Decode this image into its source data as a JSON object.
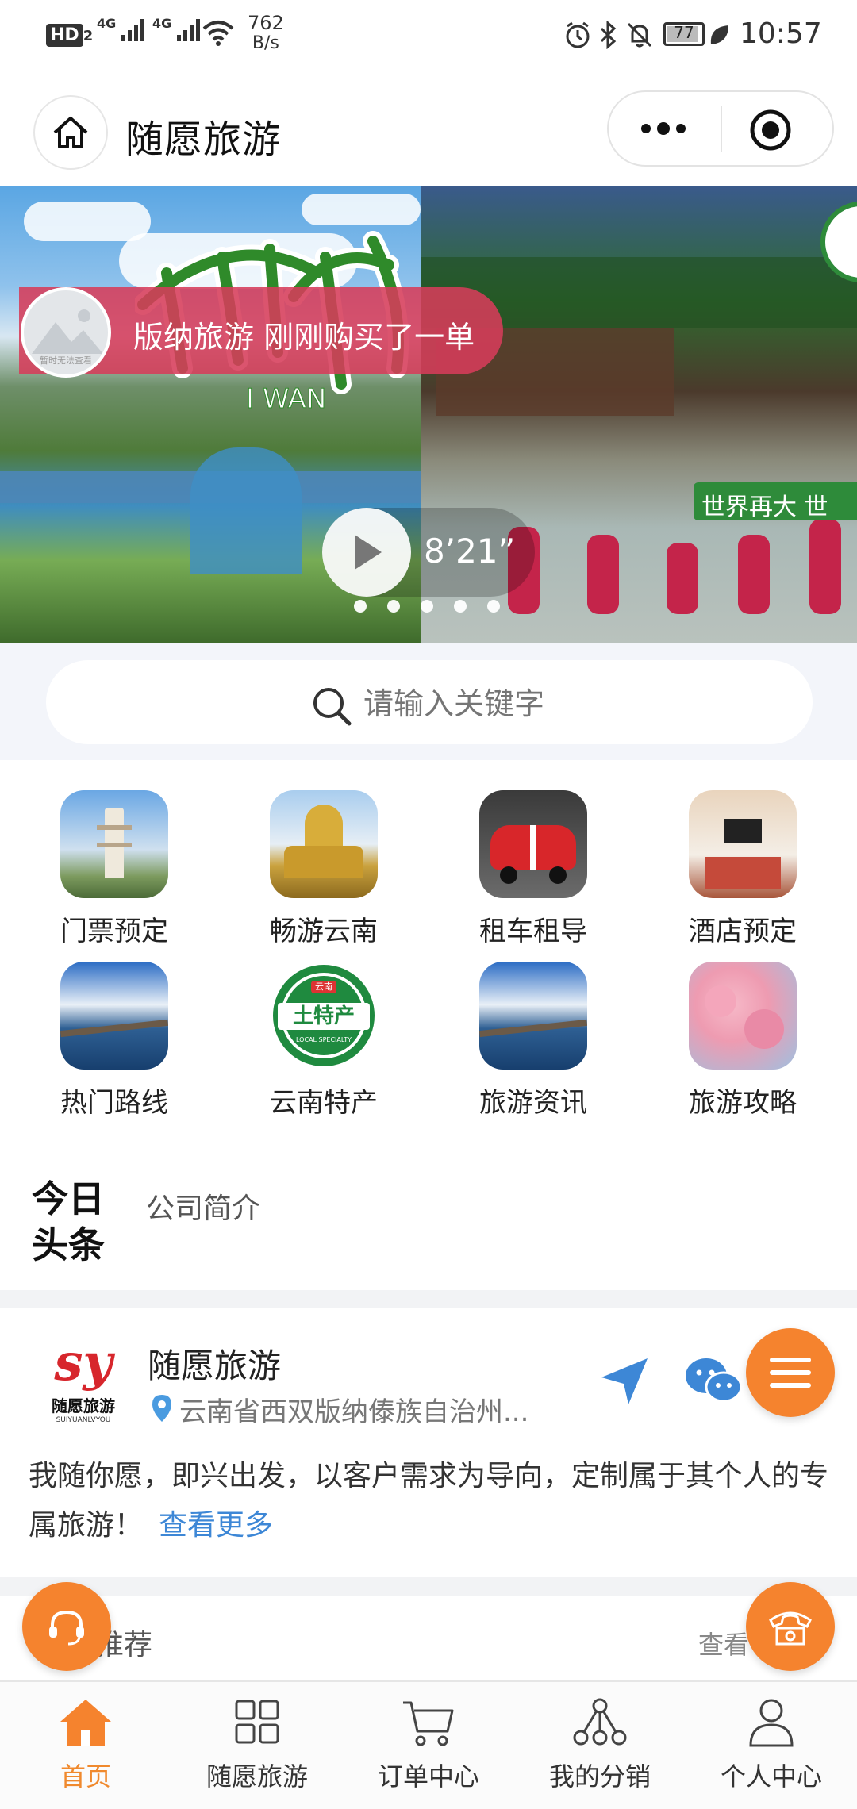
{
  "status_bar": {
    "hd_label": "HD",
    "hd_sub": "2",
    "net1": "4G",
    "net2": "4G",
    "speed_value": "762",
    "speed_unit": "B/s",
    "battery": "77",
    "time": "10:57"
  },
  "header": {
    "title": "随愿旅游"
  },
  "banner": {
    "notification": "版纳旅游 刚刚购买了一单",
    "avatar_caption": "暂时无法查看",
    "video_duration": "8’21”",
    "art_subtitle": "世界再大 世",
    "art_english": "I WAN",
    "dots_count": 5
  },
  "search": {
    "placeholder": "请输入关键字"
  },
  "grid": {
    "items": [
      {
        "label": "门票预定",
        "icon": "pagoda-icon"
      },
      {
        "label": "畅游云南",
        "icon": "golden-temple-icon"
      },
      {
        "label": "租车租导",
        "icon": "red-car-icon"
      },
      {
        "label": "酒店预定",
        "icon": "hotel-room-icon"
      },
      {
        "label": "热门路线",
        "icon": "lake-pier-icon"
      },
      {
        "label": "云南特产",
        "icon": "local-specialty-icon"
      },
      {
        "label": "旅游资讯",
        "icon": "lake-pier-icon"
      },
      {
        "label": "旅游攻略",
        "icon": "cherry-blossom-icon"
      }
    ],
    "specialty_badge_top": "云南",
    "specialty_badge_main": "土特产",
    "specialty_badge_ring": "LOCAL SPECIALTY"
  },
  "news_tabs": {
    "today_line1": "今日",
    "today_line2": "头条",
    "company": "公司简介"
  },
  "company": {
    "logo_text": "随愿旅游",
    "logo_en": "SUIYUANLVYOU",
    "logo_mark": "sy",
    "name": "随愿旅游",
    "address": "云南省西双版纳傣族自治州...",
    "description": "我随你愿，即兴出发，以客户需求为导向，定制属于其个人的专属旅游！",
    "more": "查看更多"
  },
  "recommend": {
    "title": "推荐",
    "more": "查看"
  },
  "tabbar": {
    "items": [
      {
        "label": "首页",
        "icon": "home-icon",
        "active": true
      },
      {
        "label": "随愿旅游",
        "icon": "grid-icon",
        "active": false
      },
      {
        "label": "订单中心",
        "icon": "cart-icon",
        "active": false
      },
      {
        "label": "我的分销",
        "icon": "network-icon",
        "active": false
      },
      {
        "label": "个人中心",
        "icon": "user-icon",
        "active": false
      }
    ]
  },
  "colors": {
    "accent": "#f5832e",
    "tab_active": "#f0892d",
    "link": "#3d87d6",
    "notify": "#d63c5a"
  }
}
